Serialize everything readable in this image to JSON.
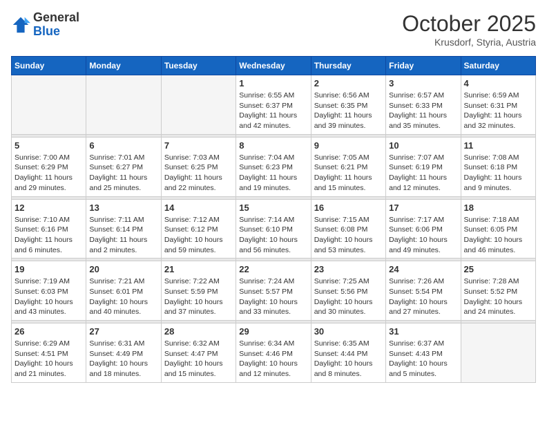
{
  "logo": {
    "general": "General",
    "blue": "Blue"
  },
  "header": {
    "month": "October 2025",
    "location": "Krusdorf, Styria, Austria"
  },
  "weekdays": [
    "Sunday",
    "Monday",
    "Tuesday",
    "Wednesday",
    "Thursday",
    "Friday",
    "Saturday"
  ],
  "weeks": [
    [
      {
        "day": "",
        "info": ""
      },
      {
        "day": "",
        "info": ""
      },
      {
        "day": "",
        "info": ""
      },
      {
        "day": "1",
        "info": "Sunrise: 6:55 AM\nSunset: 6:37 PM\nDaylight: 11 hours\nand 42 minutes."
      },
      {
        "day": "2",
        "info": "Sunrise: 6:56 AM\nSunset: 6:35 PM\nDaylight: 11 hours\nand 39 minutes."
      },
      {
        "day": "3",
        "info": "Sunrise: 6:57 AM\nSunset: 6:33 PM\nDaylight: 11 hours\nand 35 minutes."
      },
      {
        "day": "4",
        "info": "Sunrise: 6:59 AM\nSunset: 6:31 PM\nDaylight: 11 hours\nand 32 minutes."
      }
    ],
    [
      {
        "day": "5",
        "info": "Sunrise: 7:00 AM\nSunset: 6:29 PM\nDaylight: 11 hours\nand 29 minutes."
      },
      {
        "day": "6",
        "info": "Sunrise: 7:01 AM\nSunset: 6:27 PM\nDaylight: 11 hours\nand 25 minutes."
      },
      {
        "day": "7",
        "info": "Sunrise: 7:03 AM\nSunset: 6:25 PM\nDaylight: 11 hours\nand 22 minutes."
      },
      {
        "day": "8",
        "info": "Sunrise: 7:04 AM\nSunset: 6:23 PM\nDaylight: 11 hours\nand 19 minutes."
      },
      {
        "day": "9",
        "info": "Sunrise: 7:05 AM\nSunset: 6:21 PM\nDaylight: 11 hours\nand 15 minutes."
      },
      {
        "day": "10",
        "info": "Sunrise: 7:07 AM\nSunset: 6:19 PM\nDaylight: 11 hours\nand 12 minutes."
      },
      {
        "day": "11",
        "info": "Sunrise: 7:08 AM\nSunset: 6:18 PM\nDaylight: 11 hours\nand 9 minutes."
      }
    ],
    [
      {
        "day": "12",
        "info": "Sunrise: 7:10 AM\nSunset: 6:16 PM\nDaylight: 11 hours\nand 6 minutes."
      },
      {
        "day": "13",
        "info": "Sunrise: 7:11 AM\nSunset: 6:14 PM\nDaylight: 11 hours\nand 2 minutes."
      },
      {
        "day": "14",
        "info": "Sunrise: 7:12 AM\nSunset: 6:12 PM\nDaylight: 10 hours\nand 59 minutes."
      },
      {
        "day": "15",
        "info": "Sunrise: 7:14 AM\nSunset: 6:10 PM\nDaylight: 10 hours\nand 56 minutes."
      },
      {
        "day": "16",
        "info": "Sunrise: 7:15 AM\nSunset: 6:08 PM\nDaylight: 10 hours\nand 53 minutes."
      },
      {
        "day": "17",
        "info": "Sunrise: 7:17 AM\nSunset: 6:06 PM\nDaylight: 10 hours\nand 49 minutes."
      },
      {
        "day": "18",
        "info": "Sunrise: 7:18 AM\nSunset: 6:05 PM\nDaylight: 10 hours\nand 46 minutes."
      }
    ],
    [
      {
        "day": "19",
        "info": "Sunrise: 7:19 AM\nSunset: 6:03 PM\nDaylight: 10 hours\nand 43 minutes."
      },
      {
        "day": "20",
        "info": "Sunrise: 7:21 AM\nSunset: 6:01 PM\nDaylight: 10 hours\nand 40 minutes."
      },
      {
        "day": "21",
        "info": "Sunrise: 7:22 AM\nSunset: 5:59 PM\nDaylight: 10 hours\nand 37 minutes."
      },
      {
        "day": "22",
        "info": "Sunrise: 7:24 AM\nSunset: 5:57 PM\nDaylight: 10 hours\nand 33 minutes."
      },
      {
        "day": "23",
        "info": "Sunrise: 7:25 AM\nSunset: 5:56 PM\nDaylight: 10 hours\nand 30 minutes."
      },
      {
        "day": "24",
        "info": "Sunrise: 7:26 AM\nSunset: 5:54 PM\nDaylight: 10 hours\nand 27 minutes."
      },
      {
        "day": "25",
        "info": "Sunrise: 7:28 AM\nSunset: 5:52 PM\nDaylight: 10 hours\nand 24 minutes."
      }
    ],
    [
      {
        "day": "26",
        "info": "Sunrise: 6:29 AM\nSunset: 4:51 PM\nDaylight: 10 hours\nand 21 minutes."
      },
      {
        "day": "27",
        "info": "Sunrise: 6:31 AM\nSunset: 4:49 PM\nDaylight: 10 hours\nand 18 minutes."
      },
      {
        "day": "28",
        "info": "Sunrise: 6:32 AM\nSunset: 4:47 PM\nDaylight: 10 hours\nand 15 minutes."
      },
      {
        "day": "29",
        "info": "Sunrise: 6:34 AM\nSunset: 4:46 PM\nDaylight: 10 hours\nand 12 minutes."
      },
      {
        "day": "30",
        "info": "Sunrise: 6:35 AM\nSunset: 4:44 PM\nDaylight: 10 hours\nand 8 minutes."
      },
      {
        "day": "31",
        "info": "Sunrise: 6:37 AM\nSunset: 4:43 PM\nDaylight: 10 hours\nand 5 minutes."
      },
      {
        "day": "",
        "info": ""
      }
    ]
  ]
}
